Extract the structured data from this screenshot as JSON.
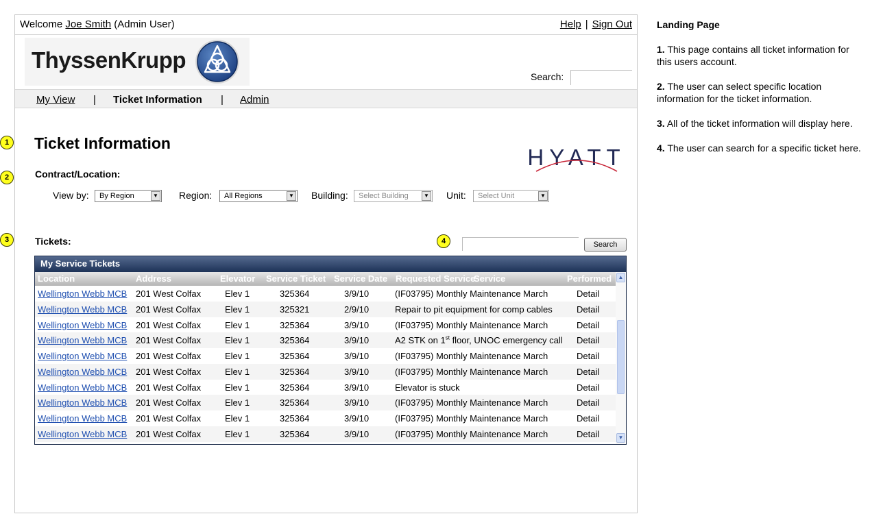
{
  "header": {
    "welcome_prefix": "Welcome",
    "user_name": "Joe Smith",
    "user_role": "(Admin User)",
    "help_link": "Help",
    "separator": "|",
    "signout_link": "Sign Out"
  },
  "brand": {
    "company_name": "ThyssenKrupp",
    "client_logo": "HYATT"
  },
  "top_search": {
    "label": "Search:",
    "value": ""
  },
  "nav": {
    "items": [
      {
        "label": "My View",
        "active": false
      },
      {
        "label": "Ticket Information",
        "active": true
      },
      {
        "label": "Admin",
        "active": false
      }
    ],
    "separator": "|"
  },
  "page": {
    "title": "Ticket Information"
  },
  "contract": {
    "label": "Contract/Location:",
    "filters": [
      {
        "label": "View by:",
        "selected": "By Region"
      },
      {
        "label": "Region:",
        "selected": "All Regions"
      },
      {
        "label": "Building:",
        "selected": "Select Building"
      },
      {
        "label": "Unit:",
        "selected": "Select Unit"
      }
    ]
  },
  "tickets": {
    "label": "Tickets:",
    "search_value": "",
    "search_button": "Search"
  },
  "grid": {
    "title": "My Service Tickets",
    "columns": [
      "Location",
      "Address",
      "Elevator",
      "Service Ticket",
      "Service Date",
      "Requested Service",
      "Service",
      "Performed"
    ],
    "rows": [
      {
        "location": "Wellington Webb MCB",
        "address": "201 West Colfax",
        "elevator": "Elev 1",
        "ticket": "325364",
        "date": "3/9/10",
        "service": "(IF03795) Monthly Maintenance March",
        "service_sup": "",
        "service_rest": "",
        "performed": "Detail"
      },
      {
        "location": "Wellington Webb MCB",
        "address": "201 West Colfax",
        "elevator": "Elev 1",
        "ticket": "325321",
        "date": "2/9/10",
        "service": "Repair to pit equipment for comp cables",
        "service_sup": "",
        "service_rest": "",
        "performed": "Detail"
      },
      {
        "location": "Wellington Webb MCB",
        "address": "201 West Colfax",
        "elevator": "Elev 1",
        "ticket": "325364",
        "date": "3/9/10",
        "service": "(IF03795) Monthly Maintenance March",
        "service_sup": "",
        "service_rest": "",
        "performed": "Detail"
      },
      {
        "location": "Wellington Webb MCB",
        "address": "201 West Colfax",
        "elevator": "Elev 1",
        "ticket": "325364",
        "date": "3/9/10",
        "service": "A2 STK on 1",
        "service_sup": "st",
        "service_rest": " floor, UNOC emergency call",
        "performed": "Detail"
      },
      {
        "location": "Wellington Webb MCB",
        "address": "201 West Colfax",
        "elevator": "Elev 1",
        "ticket": "325364",
        "date": "3/9/10",
        "service": "(IF03795) Monthly Maintenance March",
        "service_sup": "",
        "service_rest": "",
        "performed": "Detail"
      },
      {
        "location": "Wellington Webb MCB",
        "address": "201 West Colfax",
        "elevator": "Elev 1",
        "ticket": "325364",
        "date": "3/9/10",
        "service": "(IF03795) Monthly Maintenance March",
        "service_sup": "",
        "service_rest": "",
        "performed": "Detail"
      },
      {
        "location": "Wellington Webb MCB",
        "address": "201 West Colfax",
        "elevator": "Elev 1",
        "ticket": "325364",
        "date": "3/9/10",
        "service": "Elevator is stuck",
        "service_sup": "",
        "service_rest": "",
        "performed": "Detail"
      },
      {
        "location": "Wellington Webb MCB",
        "address": "201 West Colfax",
        "elevator": "Elev 1",
        "ticket": "325364",
        "date": "3/9/10",
        "service": "(IF03795) Monthly Maintenance March",
        "service_sup": "",
        "service_rest": "",
        "performed": "Detail"
      },
      {
        "location": "Wellington Webb MCB",
        "address": "201 West Colfax",
        "elevator": "Elev 1",
        "ticket": "325364",
        "date": "3/9/10",
        "service": "(IF03795) Monthly Maintenance March",
        "service_sup": "",
        "service_rest": "",
        "performed": "Detail"
      },
      {
        "location": "Wellington Webb MCB",
        "address": "201 West Colfax",
        "elevator": "Elev 1",
        "ticket": "325364",
        "date": "3/9/10",
        "service": "(IF03795) Monthly Maintenance March",
        "service_sup": "",
        "service_rest": "",
        "performed": "Detail"
      }
    ]
  },
  "callouts": [
    "1",
    "2",
    "3",
    "4"
  ],
  "notes": {
    "title": "Landing Page",
    "items": [
      {
        "num": "1.",
        "text": "This page contains all ticket information for this users account."
      },
      {
        "num": "2.",
        "text": "The user can select specific location information for the ticket information."
      },
      {
        "num": "3.",
        "text": "All of the ticket information will display here."
      },
      {
        "num": "4.",
        "text": "The user can search for a specific ticket here."
      }
    ]
  },
  "colors": {
    "grid_title_bg": "#1d3257",
    "link_blue": "#1f4fb0",
    "callout_yellow": "#ffff1e",
    "hyatt_red": "#c8273a"
  },
  "icons": [
    "thyssenkrupp-emblem-icon",
    "dropdown-arrow-icon",
    "scroll-up-icon",
    "scroll-down-icon"
  ]
}
